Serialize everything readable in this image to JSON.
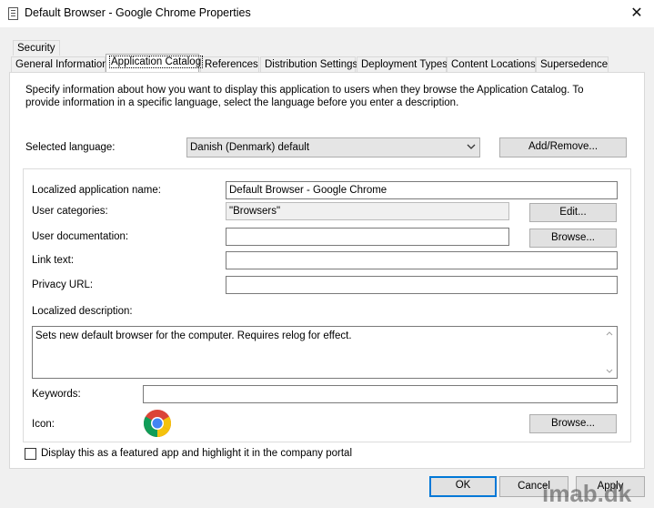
{
  "window": {
    "title": "Default Browser - Google Chrome Properties",
    "close_glyph": "✕"
  },
  "tabs": {
    "row1": [
      "Security"
    ],
    "row2": [
      "General Information",
      "Application Catalog",
      "References",
      "Distribution Settings",
      "Deployment Types",
      "Content Locations",
      "Supersedence"
    ],
    "active": "Application Catalog"
  },
  "intro": "Specify information about how you want to display this application to users when they browse the Application Catalog. To provide information in a specific language, select the language before you enter a description.",
  "language": {
    "label": "Selected language:",
    "value": "Danish (Denmark) default",
    "add_remove": "Add/Remove..."
  },
  "form": {
    "app_name_label": "Localized application name:",
    "app_name_value": "Default Browser - Google Chrome",
    "categories_label": "User categories:",
    "categories_value": "\"Browsers\"",
    "edit_btn": "Edit...",
    "doc_label": "User documentation:",
    "doc_value": "",
    "browse_btn": "Browse...",
    "link_label": "Link text:",
    "link_value": "",
    "privacy_label": "Privacy URL:",
    "privacy_value": "",
    "desc_label": "Localized description:",
    "desc_value": "Sets new default browser for the computer. Requires relog for effect.",
    "keywords_label": "Keywords:",
    "keywords_value": "",
    "icon_label": "Icon:",
    "icon_name": "chrome-icon",
    "icon_browse_btn": "Browse..."
  },
  "featured": {
    "label": "Display this as a featured app and highlight it in the company portal",
    "checked": false
  },
  "footer": {
    "ok": "OK",
    "cancel": "Cancel",
    "apply": "Apply"
  },
  "watermark": "imab.dk",
  "colors": {
    "accent": "#0078d7",
    "chrome_red": "#db4437",
    "chrome_green": "#0f9d58",
    "chrome_yellow": "#f4c20d",
    "chrome_blue": "#4285f4"
  }
}
